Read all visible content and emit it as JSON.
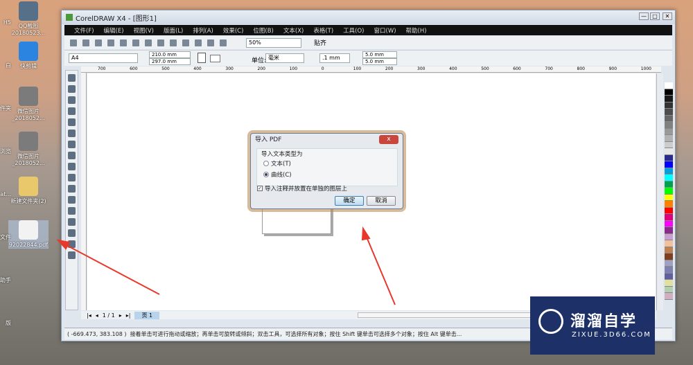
{
  "desktop": {
    "icons": [
      {
        "label": "QQ截图20180523...",
        "color": "#56708a"
      },
      {
        "label": "快剪辑",
        "color": "#2a84e0"
      },
      {
        "label": "微信图片_2018052...",
        "color": "#7b7b7b"
      },
      {
        "label": "微信图片_2018052...",
        "color": "#7b7b7b"
      },
      {
        "label": "新建文件夹(2)",
        "color": "#e8c86a"
      },
      {
        "label": "92022844.pdf",
        "color": "#f2f2f2"
      }
    ],
    "left_partial": [
      "H5",
      "白",
      "件夹",
      "浏览",
      "be at...",
      "文件",
      "助手",
      "版"
    ]
  },
  "window": {
    "title": "CorelDRAW X4 - [图形1]",
    "controls": [
      "—",
      "□",
      "✕"
    ]
  },
  "menu": [
    "文件(F)",
    "编辑(E)",
    "视图(V)",
    "版面(L)",
    "排列(A)",
    "效果(C)",
    "位图(B)",
    "文本(X)",
    "表格(T)",
    "工具(O)",
    "窗口(W)",
    "帮助(H)"
  ],
  "toolbar": {
    "zoom": "50%",
    "snap": "贴齐"
  },
  "property_bar": {
    "paper": "A4",
    "width": "210.0 mm",
    "height": "297.0 mm",
    "unit_label": "单位:",
    "unit": "毫米",
    "nudge": ".1 mm",
    "dup_x": "5.0 mm",
    "dup_y": "5.0 mm"
  },
  "ruler": {
    "ticks": [
      "700",
      "600",
      "500",
      "400",
      "300",
      "200",
      "100",
      "0",
      "100",
      "200",
      "300",
      "400",
      "500",
      "600",
      "700",
      "800",
      "900",
      "1000"
    ],
    "unit": "毫米"
  },
  "palette": [
    "#ffffff",
    "#000000",
    "#1a1a1a",
    "#333",
    "#4d4d4d",
    "#666",
    "#808080",
    "#999",
    "#b3b3b3",
    "#ccc",
    "#e6e6e6",
    "#2a2a8c",
    "#0000ff",
    "#00a0e0",
    "#00ffff",
    "#00a050",
    "#00ff00",
    "#ffff00",
    "#ff8000",
    "#ff0000",
    "#e0007a",
    "#ff00ff",
    "#8c2b8c",
    "#c8a0d0",
    "#f0c0a0",
    "#c08050",
    "#804020",
    "#a0a0c0",
    "#8080b0",
    "#6060a0",
    "#e0e0a0",
    "#b0d0b0",
    "#d0b0c0"
  ],
  "page_nav": {
    "position": "1 / 1",
    "tab": "页 1"
  },
  "status": {
    "coords": "( -669.473, 383.108 )",
    "hint": "接着单击可进行拖动或缩放；再单击可旋转或倾斜；双击工具，可选择所有对象；按住 Shift 键单击可选择多个对象；按住 Alt 键单击..."
  },
  "dialog": {
    "title": "导入 PDF",
    "close": "x",
    "group": "导入文本类型为",
    "opt_text": "文本(T)",
    "opt_curve": "曲线(C)",
    "opt_curve_selected": true,
    "checkbox": "导入注释并放置在单独的图层上",
    "checkbox_checked": true,
    "ok": "确定",
    "cancel": "取消"
  },
  "watermark": {
    "brand": "溜溜自学",
    "url": "ZIXUE.3D66.COM"
  },
  "colors": {
    "arrow": "#e8382c",
    "watermark_bg": "#1d3168"
  }
}
